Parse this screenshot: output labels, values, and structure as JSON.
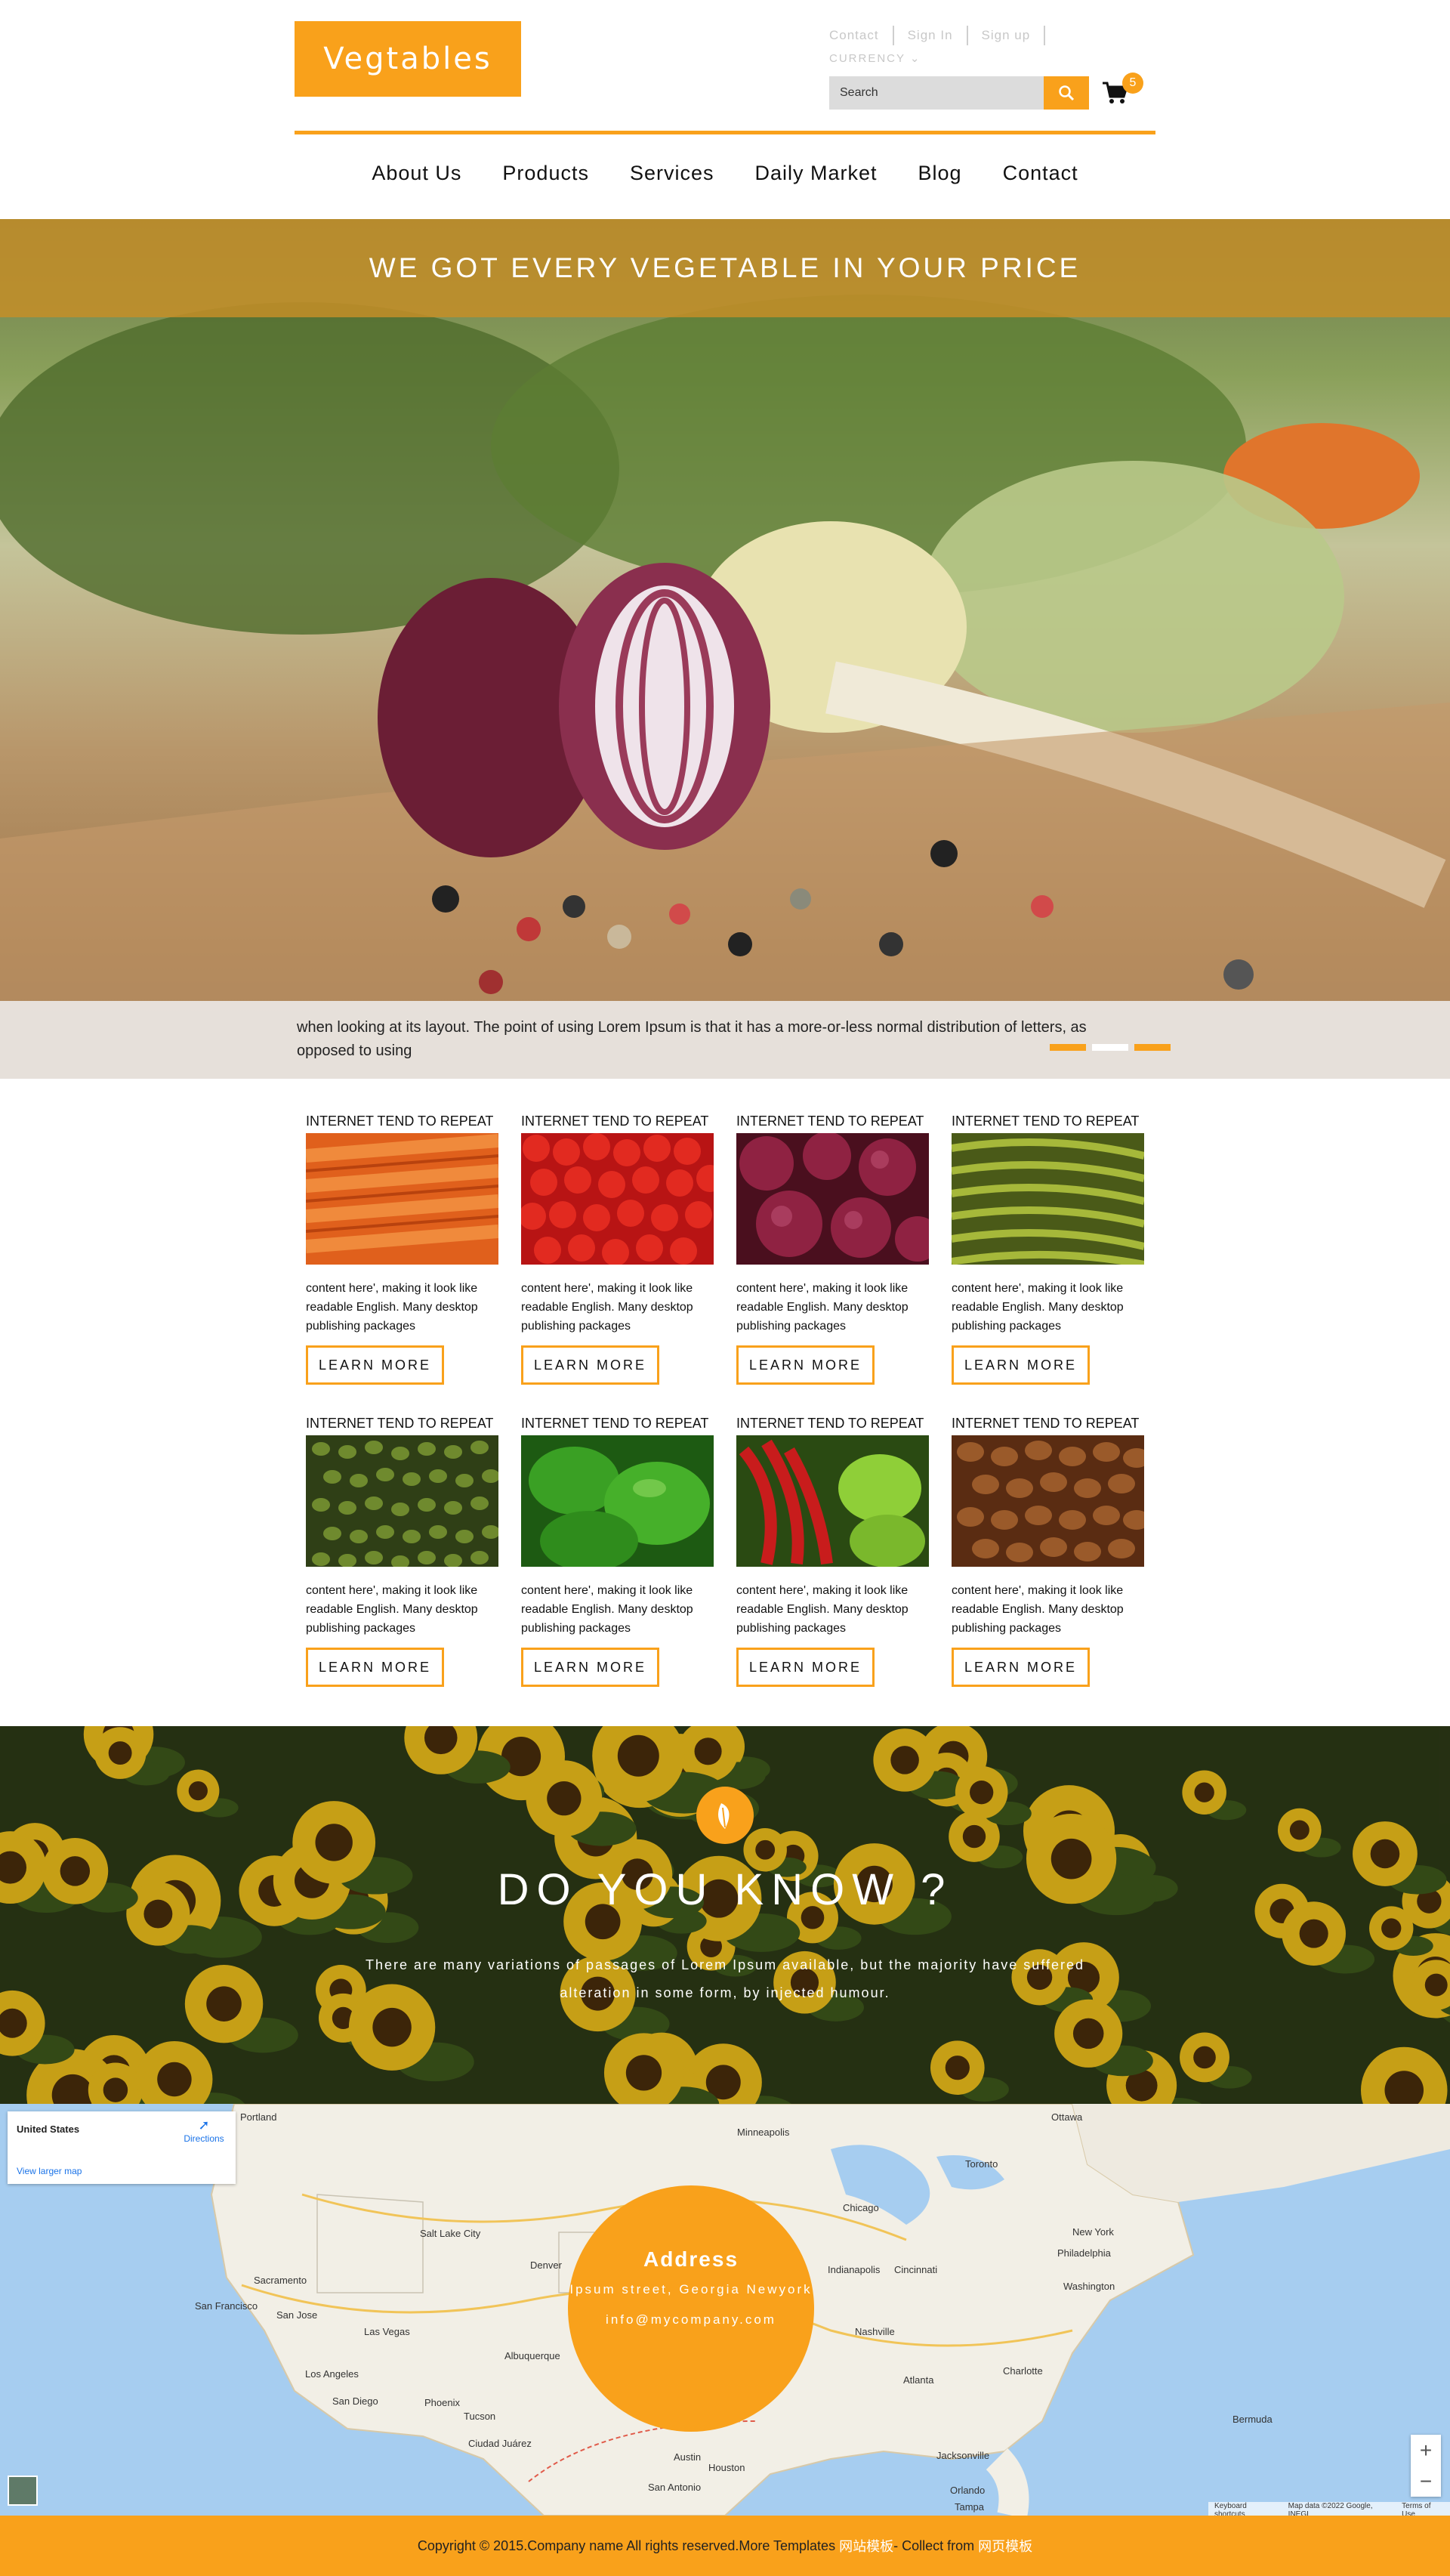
{
  "header": {
    "logo": "Vegtables",
    "links": [
      "Contact",
      "Sign In",
      "Sign up"
    ],
    "currency": "CURRENCY",
    "search_placeholder": "Search",
    "cart_count": "5"
  },
  "nav": [
    "About Us",
    "Products",
    "Services",
    "Daily Market",
    "Blog",
    "Contact"
  ],
  "hero": {
    "banner": "WE GOT EVERY VEGETABLE IN YOUR PRICE",
    "caption": "when looking at its layout. The point of using Lorem Ipsum is that it has a more-or-less normal distribution of letters, as opposed to using"
  },
  "products": [
    {
      "title": "INTERNET TEND TO REPEAT",
      "image": "carrots",
      "text": "content here', making it look like readable English. Many desktop publishing packages",
      "button": "LEARN MORE"
    },
    {
      "title": "INTERNET TEND TO REPEAT",
      "image": "tomatoes",
      "text": "content here', making it look like readable English. Many desktop publishing packages",
      "button": "LEARN MORE"
    },
    {
      "title": "INTERNET TEND TO REPEAT",
      "image": "red-onions",
      "text": "content here', making it look like readable English. Many desktop publishing packages",
      "button": "LEARN MORE"
    },
    {
      "title": "INTERNET TEND TO REPEAT",
      "image": "green-beans",
      "text": "content here', making it look like readable English. Many desktop publishing packages",
      "button": "LEARN MORE"
    },
    {
      "title": "INTERNET TEND TO REPEAT",
      "image": "peas",
      "text": "content here', making it look like readable English. Many desktop publishing packages",
      "button": "LEARN MORE"
    },
    {
      "title": "INTERNET TEND TO REPEAT",
      "image": "green-peppers",
      "text": "content here', making it look like readable English. Many desktop publishing packages",
      "button": "LEARN MORE"
    },
    {
      "title": "INTERNET TEND TO REPEAT",
      "image": "chili-peppers",
      "text": "content here', making it look like readable English. Many desktop publishing packages",
      "button": "LEARN MORE"
    },
    {
      "title": "INTERNET TEND TO REPEAT",
      "image": "coffee-beans",
      "text": "content here', making it look like readable English. Many desktop publishing packages",
      "button": "LEARN MORE"
    }
  ],
  "know": {
    "title": "DO YOU KNOW ?",
    "text": "There are many variations of passages of Lorem Ipsum available, but the majority have suffered alteration in some form, by injected humour."
  },
  "map": {
    "location": "United States",
    "directions": "Directions",
    "larger": "View larger map",
    "address_title": "Address",
    "street": "Ipsum street, Georgia Newyork",
    "email": "info@mycompany.com",
    "attribution": [
      "Keyboard shortcuts",
      "Map data ©2022 Google, INEGI",
      "Terms of Use"
    ],
    "cities": [
      "Portland",
      "Minneapolis",
      "Ottawa",
      "Toronto",
      "Chicago",
      "Salt Lake City",
      "Denver",
      "Indianapolis",
      "Cincinnati",
      "New York",
      "Philadelphia",
      "Washington",
      "Sacramento",
      "San Francisco",
      "San Jose",
      "Las Vegas",
      "Nashville",
      "Charlotte",
      "Los Angeles",
      "Albuquerque",
      "Atlanta",
      "San Diego",
      "Phoenix",
      "Tucson",
      "Ciudad Juárez",
      "Austin",
      "Houston",
      "San Antonio",
      "Jacksonville",
      "Bermuda",
      "Orlando",
      "Tampa"
    ]
  },
  "footer": {
    "prefix": "Copyright © 2015.Company name All rights reserved.More Templates ",
    "cn1": "网站模板",
    "mid": " - Collect from ",
    "cn2": "网页模板"
  },
  "colors": {
    "accent": "#f9a11b",
    "banner": "#c48e28",
    "map_water": "#a6cdf0"
  }
}
